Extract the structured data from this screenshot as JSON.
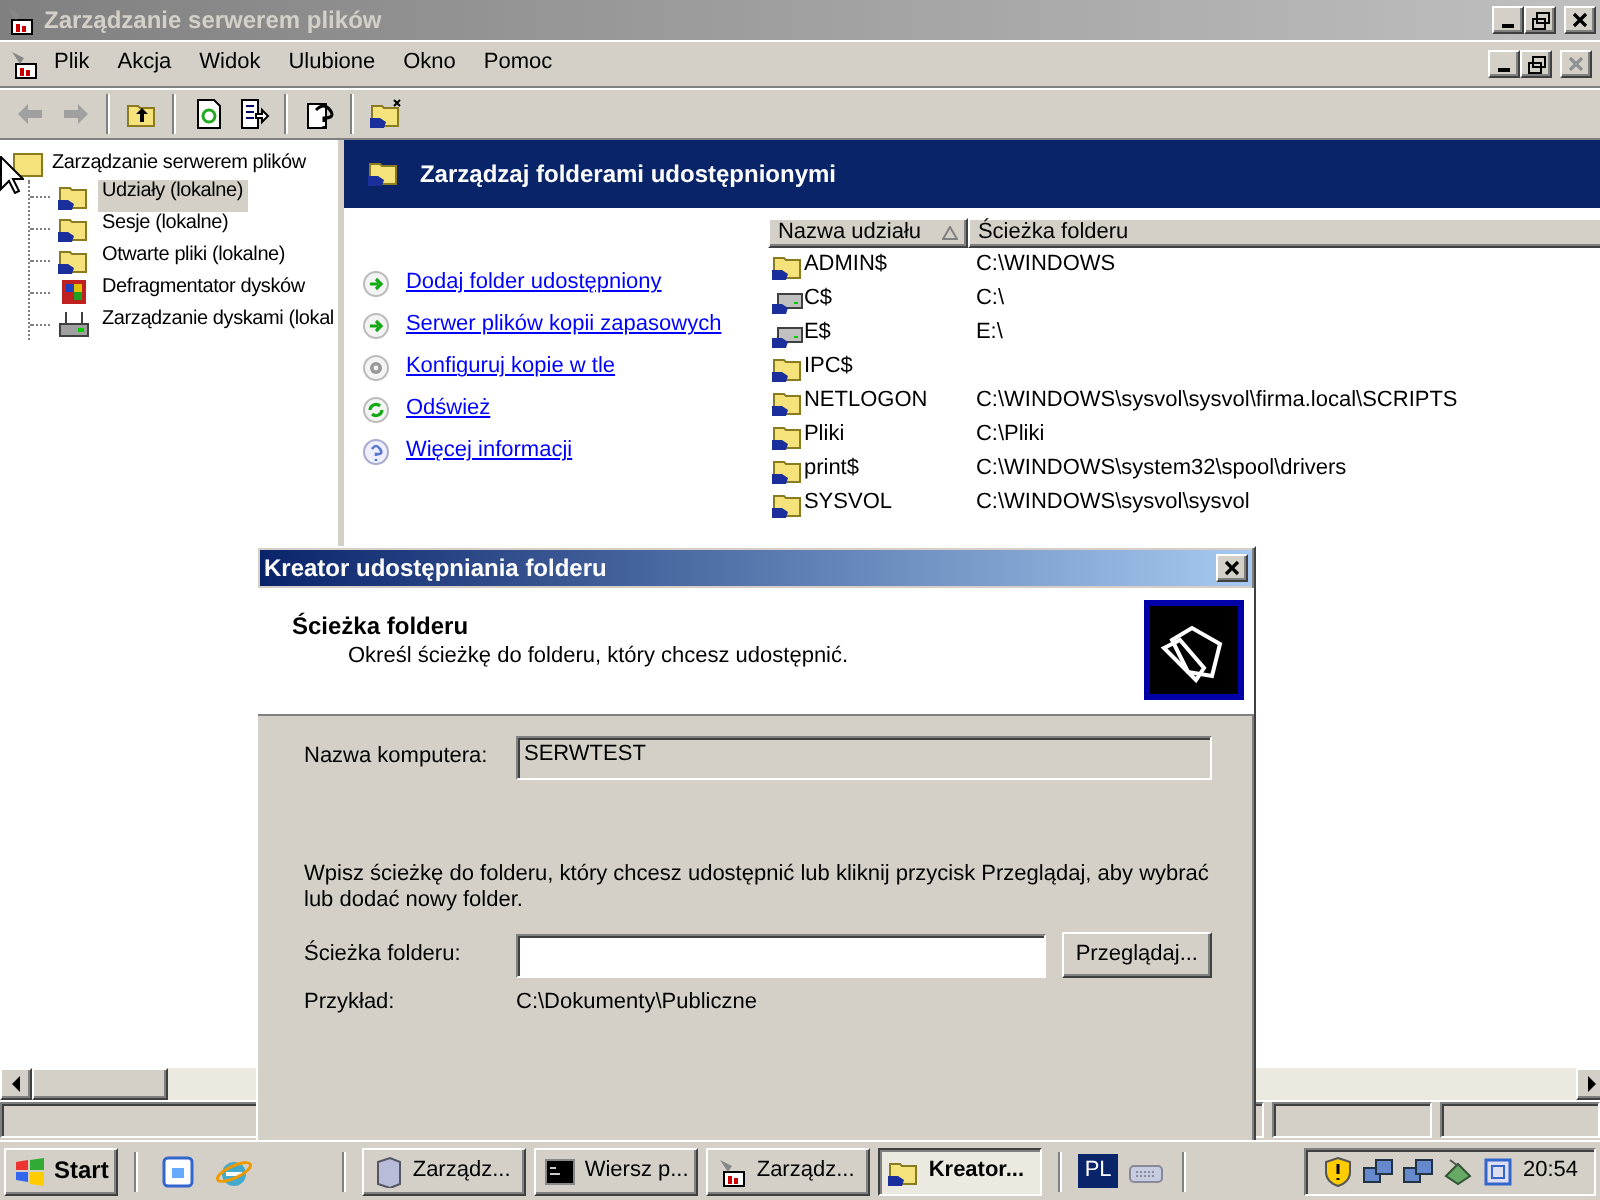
{
  "window": {
    "title": "Zarządzanie serwerem plików",
    "active": false
  },
  "menu": [
    "Plik",
    "Akcja",
    "Widok",
    "Ulubione",
    "Okno",
    "Pomoc"
  ],
  "child_window": {
    "close_disabled": true
  },
  "toolbar": [
    {
      "kind": "back",
      "disabled": true
    },
    {
      "kind": "forward",
      "disabled": true
    },
    {
      "kind": "sep"
    },
    {
      "kind": "up"
    },
    {
      "kind": "sep"
    },
    {
      "kind": "refresh"
    },
    {
      "kind": "export"
    },
    {
      "kind": "sep"
    },
    {
      "kind": "help"
    },
    {
      "kind": "sep"
    },
    {
      "kind": "share"
    }
  ],
  "tree": {
    "label": "Zarządzanie serwerem plików",
    "children": [
      {
        "label": "Udziały (lokalne)",
        "kind": "share",
        "selected": true
      },
      {
        "label": "Sesje (lokalne)",
        "kind": "share",
        "selected": false
      },
      {
        "label": "Otwarte pliki (lokalne)",
        "kind": "share",
        "selected": false
      },
      {
        "label": "Defragmentator dysków",
        "kind": "defrag",
        "selected": false
      },
      {
        "label": "Zarządzanie dyskami (lokal",
        "kind": "disk",
        "selected": false
      }
    ]
  },
  "taskpad": {
    "title": "Zarządzaj folderami udostępnionymi",
    "links": [
      {
        "label": "Dodaj folder udostępniony",
        "kind": "add"
      },
      {
        "label": "Serwer plików kopii zapasowych",
        "kind": "add"
      },
      {
        "label": "Konfiguruj kopie w tle",
        "kind": "config"
      },
      {
        "label": "Odśwież",
        "kind": "refresh"
      },
      {
        "label": "Więcej informacji",
        "kind": "help"
      }
    ]
  },
  "list": {
    "columns": [
      {
        "label": "Nazwa udziału",
        "sorted": true
      },
      {
        "label": "Ścieżka folderu",
        "sorted": false
      }
    ],
    "rows": [
      {
        "kind": "folder",
        "name": "ADMIN$",
        "path": "C:\\WINDOWS"
      },
      {
        "kind": "drive",
        "name": "C$",
        "path": "C:\\"
      },
      {
        "kind": "drive",
        "name": "E$",
        "path": "E:\\"
      },
      {
        "kind": "folder",
        "name": "IPC$"
      },
      {
        "kind": "folder",
        "name": "NETLOGON",
        "path": "C:\\WINDOWS\\sysvol\\sysvol\\firma.local\\SCRIPTS"
      },
      {
        "kind": "folder",
        "name": "Pliki",
        "path": "C:\\Pliki"
      },
      {
        "kind": "folder",
        "name": "print$",
        "path": "C:\\WINDOWS\\system32\\spool\\drivers"
      },
      {
        "kind": "folder",
        "name": "SYSVOL",
        "path": "C:\\WINDOWS\\sysvol\\sysvol"
      }
    ]
  },
  "dialog": {
    "title": "Kreator udostępniania folderu",
    "heading": "Ścieżka folderu",
    "subheading": "Określ ścieżkę do folderu, który chcesz udostępnić.",
    "computer_name": {
      "label": "Nazwa komputera:",
      "value": "SERWTEST"
    },
    "instruction": "Wpisz ścieżkę do folderu, który chcesz udostępnić lub kliknij przycisk Przeglądaj, aby wybrać lub dodać nowy folder.",
    "folder_path": {
      "label": "Ścieżka folderu:"
    },
    "browse_button": "Przeglądaj...",
    "example": {
      "label": "Przykład:",
      "value": "C:\\Dokumenty\\Publiczne"
    }
  },
  "taskbar": {
    "start": "Start",
    "tasks": [
      {
        "label": "Zarządz...",
        "kind": "server",
        "selected": false
      },
      {
        "label": "Wiersz p...",
        "kind": "console",
        "selected": false
      },
      {
        "label": "Zarządz...",
        "kind": "tools",
        "selected": false
      },
      {
        "label": "Kreator...",
        "kind": "share",
        "selected": true
      }
    ],
    "language": "PL",
    "clock": "20:54"
  }
}
